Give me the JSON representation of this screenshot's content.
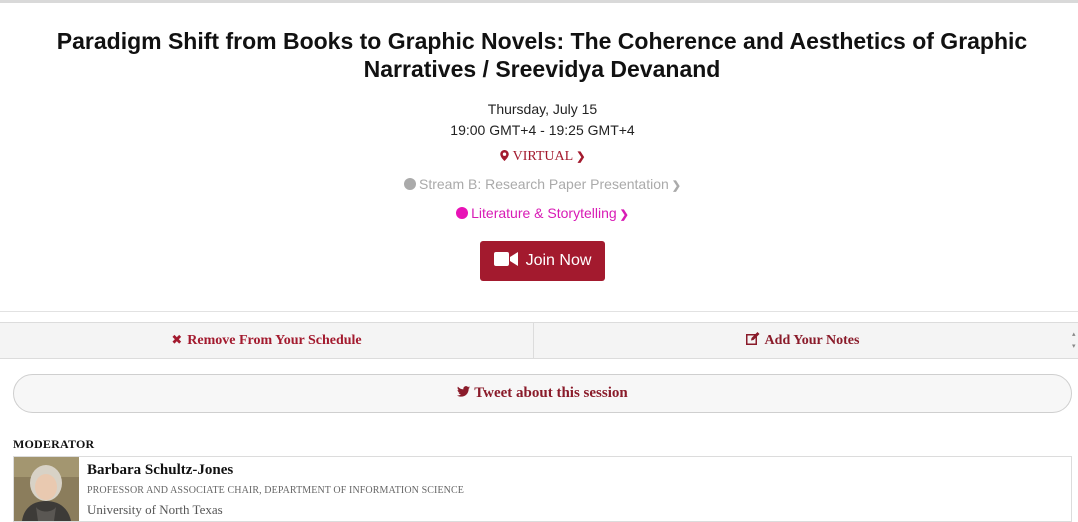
{
  "session": {
    "title": "Paradigm Shift from Books to Graphic Novels: The Coherence and Aesthetics of Graphic Narratives / Sreevidya Devanand",
    "date": "Thursday, July 15",
    "time": "19:00 GMT+4 - 19:25 GMT+4",
    "venue": "VIRTUAL",
    "stream": "Stream B: Research Paper Presentation",
    "track": "Literature & Storytelling",
    "join_label": "Join Now"
  },
  "actions": {
    "remove_label": "Remove From Your Schedule",
    "notes_label": "Add Your Notes",
    "tweet_label": "Tweet about this session"
  },
  "moderator": {
    "section_label": "MODERATOR",
    "name": "Barbara Schultz-Jones",
    "role": "PROFESSOR AND ASSOCIATE CHAIR, DEPARTMENT OF INFORMATION SCIENCE",
    "organization": "University of North Texas"
  },
  "icons": {
    "venue": "map-marker-icon",
    "join": "video-camera-icon",
    "remove": "close-icon",
    "notes": "edit-icon",
    "tweet": "twitter-icon"
  },
  "colors": {
    "accent": "#a31a2e",
    "stream_dot": "#aaaaaa",
    "track_dot": "#e812b6"
  }
}
